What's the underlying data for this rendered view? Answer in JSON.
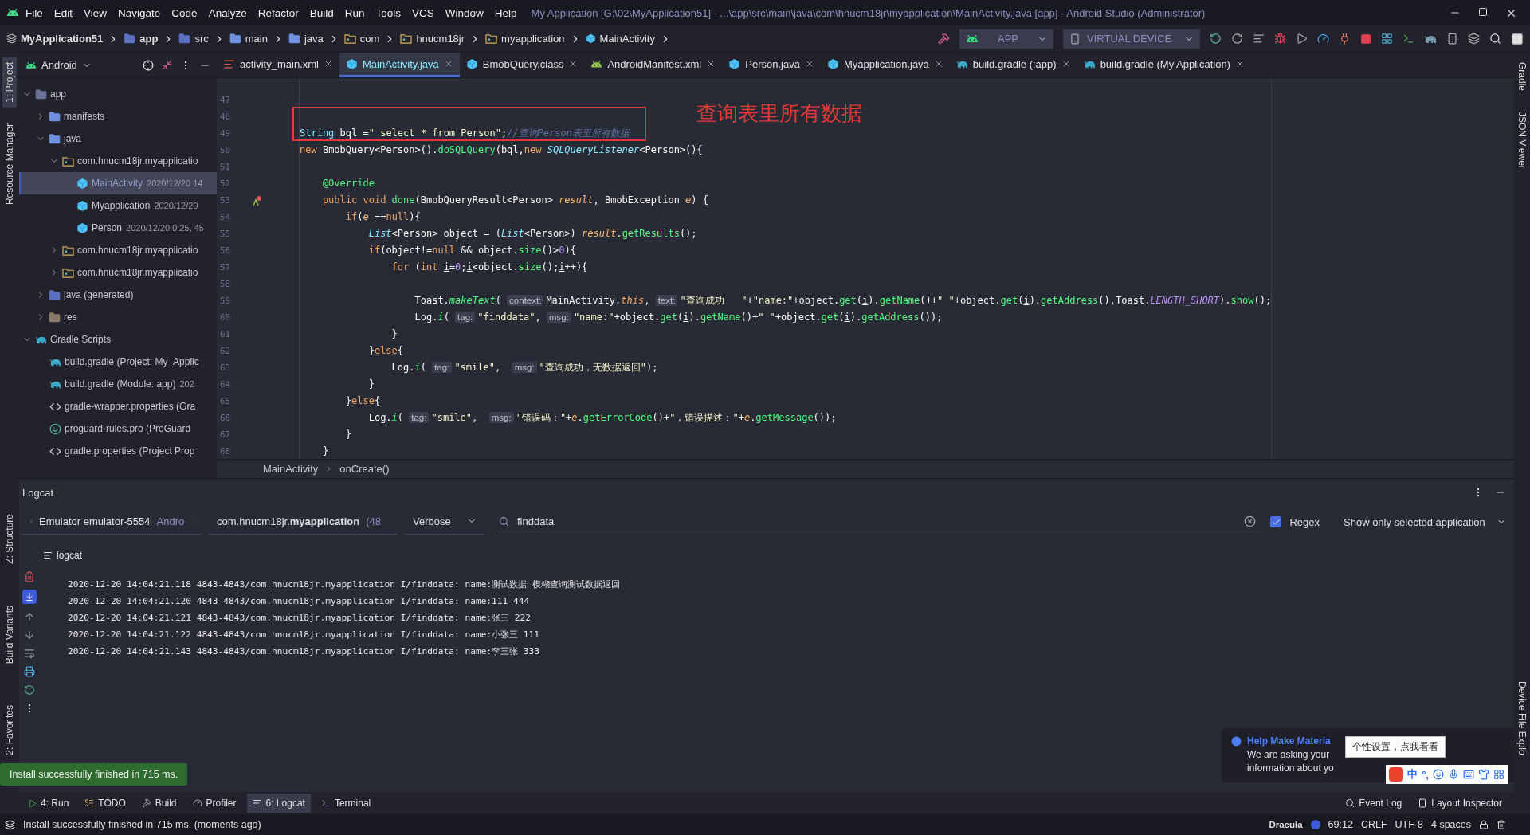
{
  "menu_bar": {
    "items": [
      "File",
      "Edit",
      "View",
      "Navigate",
      "Code",
      "Analyze",
      "Refactor",
      "Build",
      "Run",
      "Tools",
      "VCS",
      "Window",
      "Help"
    ],
    "title": "My Application [G:\\02\\MyApplication51] - ...\\app\\src\\main\\java\\com\\hnucm18jr\\myapplication\\MainActivity.java [app] - Android Studio (Administrator)"
  },
  "breadcrumbs": [
    {
      "label": "MyApplication51",
      "kind": "project"
    },
    {
      "label": "app",
      "kind": "module"
    },
    {
      "label": "src",
      "kind": "source"
    },
    {
      "label": "main",
      "kind": "folder"
    },
    {
      "label": "java",
      "kind": "folder"
    },
    {
      "label": "com",
      "kind": "package"
    },
    {
      "label": "hnucm18jr",
      "kind": "package"
    },
    {
      "label": "myapplication",
      "kind": "package"
    },
    {
      "label": "MainActivity",
      "kind": "class"
    }
  ],
  "run_toolbar": {
    "configuration": "APP",
    "device": "VIRTUAL DEVICE"
  },
  "left_tool_strip": {
    "top": [
      {
        "label": "1: Project",
        "selected": true
      },
      {
        "label": "Resource Manager",
        "selected": false
      }
    ],
    "bottom": [
      {
        "label": "Z: Structure",
        "selected": false
      },
      {
        "label": "Build Variants",
        "selected": false
      },
      {
        "label": "2: Favorites",
        "selected": false
      }
    ]
  },
  "right_tool_strip": {
    "top": [
      "Gradle",
      "JSON Viewer"
    ],
    "bottom": [
      "Device File Explo"
    ]
  },
  "project_panel": {
    "view": "Android",
    "tree": [
      {
        "label": "app",
        "kind": "module",
        "expanded": true,
        "selected": false,
        "children": [
          {
            "label": "manifests",
            "kind": "folder",
            "expanded": false,
            "selected": false
          },
          {
            "label": "java",
            "kind": "folder",
            "expanded": true,
            "selected": false,
            "children": [
              {
                "label": "com.hnucm18jr.myapplicatio",
                "kind": "package",
                "expanded": true,
                "selected": false,
                "children": [
                  {
                    "label": "MainActivity",
                    "date": "2020/12/20 14",
                    "kind": "class",
                    "selected": true
                  },
                  {
                    "label": "Myapplication",
                    "date": "2020/12/20",
                    "kind": "class",
                    "selected": false
                  },
                  {
                    "label": "Person",
                    "date": "2020/12/20 0:25, 45",
                    "kind": "class",
                    "selected": false
                  }
                ]
              },
              {
                "label": "com.hnucm18jr.myapplicatio",
                "kind": "package",
                "expanded": false,
                "selected": false
              },
              {
                "label": "com.hnucm18jr.myapplicatio",
                "kind": "package",
                "expanded": false,
                "selected": false
              }
            ]
          },
          {
            "label": "java (generated)",
            "kind": "generated",
            "expanded": false,
            "selected": false
          },
          {
            "label": "res",
            "kind": "resources",
            "expanded": false,
            "selected": false
          }
        ]
      },
      {
        "label": "Gradle Scripts",
        "kind": "gradle",
        "expanded": true,
        "selected": false,
        "children": [
          {
            "label": "build.gradle (Project: My_Applic",
            "kind": "gradle",
            "selected": false
          },
          {
            "label": "build.gradle (Module: app)",
            "date": "202",
            "kind": "gradle",
            "selected": false
          },
          {
            "label": "gradle-wrapper.properties (Gra",
            "kind": "properties",
            "selected": false
          },
          {
            "label": "proguard-rules.pro (ProGuard",
            "kind": "proguard",
            "selected": false
          },
          {
            "label": "gradle.properties (Project Prop",
            "kind": "properties",
            "selected": false
          }
        ]
      }
    ]
  },
  "editor_tabs": [
    {
      "label": "activity_main.xml",
      "kind": "layout",
      "selected": false
    },
    {
      "label": "MainActivity.java",
      "kind": "class",
      "selected": true
    },
    {
      "label": "BmobQuery.class",
      "kind": "class",
      "selected": false
    },
    {
      "label": "AndroidManifest.xml",
      "kind": "manifest",
      "selected": false
    },
    {
      "label": "Person.java",
      "kind": "class",
      "selected": false
    },
    {
      "label": "Myapplication.java",
      "kind": "class",
      "selected": false
    },
    {
      "label": "build.gradle (:app)",
      "kind": "gradle",
      "selected": false
    },
    {
      "label": "build.gradle (My Application)",
      "kind": "gradle",
      "selected": false
    }
  ],
  "code_lines": [
    {
      "number": "47"
    },
    {
      "number": "48"
    },
    {
      "number": "49",
      "segments": [
        {
          "text": "String",
          "kind": "type"
        },
        {
          "text": " bql =",
          "kind": "plain"
        },
        {
          "text": "\" select * from Person\"",
          "kind": "string"
        },
        {
          "text": ";",
          "kind": "plain"
        },
        {
          "text": "//查询Person表里所有数据",
          "kind": "comment"
        }
      ]
    },
    {
      "number": "50",
      "segments": [
        {
          "text": "new",
          "kind": "keyword"
        },
        {
          "text": " BmobQuery<Person>().",
          "kind": "plain"
        },
        {
          "text": "doSQLQuery",
          "kind": "method"
        },
        {
          "text": "(bql,",
          "kind": "plain"
        },
        {
          "text": "new",
          "kind": "keyword"
        },
        {
          "text": " SQLQueryListener",
          "kind": "type_italic"
        },
        {
          "text": "<Person>(){",
          "kind": "plain"
        }
      ]
    },
    {
      "number": "51"
    },
    {
      "number": "52",
      "segments": [
        {
          "text": "    @Override",
          "kind": "annotation"
        }
      ]
    },
    {
      "number": "53",
      "override_mark": true,
      "segments": [
        {
          "text": "    public void",
          "kind": "keyword"
        },
        {
          "text": " done",
          "kind": "method"
        },
        {
          "text": "(BmobQueryResult<Person> ",
          "kind": "plain"
        },
        {
          "text": "result",
          "kind": "param"
        },
        {
          "text": ", BmobException ",
          "kind": "plain"
        },
        {
          "text": "e",
          "kind": "param"
        },
        {
          "text": ") {",
          "kind": "plain"
        }
      ]
    },
    {
      "number": "54",
      "segments": [
        {
          "text": "        if",
          "kind": "keyword"
        },
        {
          "text": "(",
          "kind": "plain"
        },
        {
          "text": "e",
          "kind": "param"
        },
        {
          "text": " ==",
          "kind": "plain"
        },
        {
          "text": "null",
          "kind": "keyword"
        },
        {
          "text": "){",
          "kind": "plain"
        }
      ]
    },
    {
      "number": "55",
      "segments": [
        {
          "text": "            List",
          "kind": "type_italic"
        },
        {
          "text": "<Person> object = (",
          "kind": "plain"
        },
        {
          "text": "List",
          "kind": "type_italic"
        },
        {
          "text": "<Person>) ",
          "kind": "plain"
        },
        {
          "text": "result",
          "kind": "param"
        },
        {
          "text": ".",
          "kind": "plain"
        },
        {
          "text": "getResults",
          "kind": "method"
        },
        {
          "text": "();",
          "kind": "plain"
        }
      ]
    },
    {
      "number": "56",
      "segments": [
        {
          "text": "            if",
          "kind": "keyword"
        },
        {
          "text": "(object!=",
          "kind": "plain"
        },
        {
          "text": "null",
          "kind": "keyword"
        },
        {
          "text": " && object.",
          "kind": "plain"
        },
        {
          "text": "size",
          "kind": "method"
        },
        {
          "text": "()>",
          "kind": "plain"
        },
        {
          "text": "0",
          "kind": "number"
        },
        {
          "text": "){",
          "kind": "plain"
        }
      ]
    },
    {
      "number": "57",
      "segments": [
        {
          "text": "                for",
          "kind": "keyword"
        },
        {
          "text": " (",
          "kind": "plain"
        },
        {
          "text": "int ",
          "kind": "keyword"
        },
        {
          "text": "i",
          "kind": "loop_var"
        },
        {
          "text": "=",
          "kind": "plain"
        },
        {
          "text": "0",
          "kind": "number"
        },
        {
          "text": ";",
          "kind": "plain"
        },
        {
          "text": "i",
          "kind": "loop_var"
        },
        {
          "text": "<object.",
          "kind": "plain"
        },
        {
          "text": "size",
          "kind": "method"
        },
        {
          "text": "();",
          "kind": "plain"
        },
        {
          "text": "i",
          "kind": "loop_var"
        },
        {
          "text": "++){",
          "kind": "plain"
        }
      ]
    },
    {
      "number": "58"
    },
    {
      "number": "59",
      "segments": [
        {
          "text": "                    Toast.",
          "kind": "plain"
        },
        {
          "text": "makeText",
          "kind": "method_italic"
        },
        {
          "text": "( ",
          "kind": "plain"
        },
        {
          "text": "context:",
          "kind": "hint"
        },
        {
          "text": "MainActivity.",
          "kind": "plain"
        },
        {
          "text": "this",
          "kind": "keyword_italic"
        },
        {
          "text": ", ",
          "kind": "plain"
        },
        {
          "text": "text:",
          "kind": "hint"
        },
        {
          "text": "\"查询成功   \"",
          "kind": "string"
        },
        {
          "text": "+",
          "kind": "plain"
        },
        {
          "text": "\"name:\"",
          "kind": "string"
        },
        {
          "text": "+object.",
          "kind": "plain"
        },
        {
          "text": "get",
          "kind": "method"
        },
        {
          "text": "(",
          "kind": "plain"
        },
        {
          "text": "i",
          "kind": "loop_var"
        },
        {
          "text": ").",
          "kind": "plain"
        },
        {
          "text": "getName",
          "kind": "method"
        },
        {
          "text": "()+",
          "kind": "plain"
        },
        {
          "text": "\" \"",
          "kind": "string"
        },
        {
          "text": "+object.",
          "kind": "plain"
        },
        {
          "text": "get",
          "kind": "method"
        },
        {
          "text": "(",
          "kind": "plain"
        },
        {
          "text": "i",
          "kind": "loop_var"
        },
        {
          "text": ").",
          "kind": "plain"
        },
        {
          "text": "getAddress",
          "kind": "method"
        },
        {
          "text": "(),Toast.",
          "kind": "plain"
        },
        {
          "text": "LENGTH_SHORT",
          "kind": "constant"
        },
        {
          "text": ").",
          "kind": "plain"
        },
        {
          "text": "show",
          "kind": "method"
        },
        {
          "text": "();",
          "kind": "plain"
        }
      ]
    },
    {
      "number": "60",
      "segments": [
        {
          "text": "                    Log.",
          "kind": "plain"
        },
        {
          "text": "i",
          "kind": "method_italic"
        },
        {
          "text": "( ",
          "kind": "plain"
        },
        {
          "text": "tag:",
          "kind": "hint"
        },
        {
          "text": "\"finddata\"",
          "kind": "string"
        },
        {
          "text": ", ",
          "kind": "plain"
        },
        {
          "text": "msg:",
          "kind": "hint"
        },
        {
          "text": "\"name:\"",
          "kind": "string"
        },
        {
          "text": "+object.",
          "kind": "plain"
        },
        {
          "text": "get",
          "kind": "method"
        },
        {
          "text": "(",
          "kind": "plain"
        },
        {
          "text": "i",
          "kind": "loop_var"
        },
        {
          "text": ").",
          "kind": "plain"
        },
        {
          "text": "getName",
          "kind": "method"
        },
        {
          "text": "()+",
          "kind": "plain"
        },
        {
          "text": "\" \"",
          "kind": "string"
        },
        {
          "text": "+object.",
          "kind": "plain"
        },
        {
          "text": "get",
          "kind": "method"
        },
        {
          "text": "(",
          "kind": "plain"
        },
        {
          "text": "i",
          "kind": "loop_var"
        },
        {
          "text": ").",
          "kind": "plain"
        },
        {
          "text": "getAddress",
          "kind": "method"
        },
        {
          "text": "());",
          "kind": "plain"
        }
      ]
    },
    {
      "number": "61",
      "segments": [
        {
          "text": "                }",
          "kind": "plain"
        }
      ]
    },
    {
      "number": "62",
      "segments": [
        {
          "text": "            }",
          "kind": "plain"
        },
        {
          "text": "else",
          "kind": "keyword"
        },
        {
          "text": "{",
          "kind": "plain"
        }
      ]
    },
    {
      "number": "63",
      "segments": [
        {
          "text": "                Log.",
          "kind": "plain"
        },
        {
          "text": "i",
          "kind": "method_italic"
        },
        {
          "text": "( ",
          "kind": "plain"
        },
        {
          "text": "tag:",
          "kind": "hint"
        },
        {
          "text": "\"smile\"",
          "kind": "string"
        },
        {
          "text": ",  ",
          "kind": "plain"
        },
        {
          "text": "msg:",
          "kind": "hint"
        },
        {
          "text": "\"查询成功，无数据返回\"",
          "kind": "string"
        },
        {
          "text": ");",
          "kind": "plain"
        }
      ]
    },
    {
      "number": "64",
      "segments": [
        {
          "text": "            }",
          "kind": "plain"
        }
      ]
    },
    {
      "number": "65",
      "segments": [
        {
          "text": "        }",
          "kind": "plain"
        },
        {
          "text": "else",
          "kind": "keyword"
        },
        {
          "text": "{",
          "kind": "plain"
        }
      ]
    },
    {
      "number": "66",
      "segments": [
        {
          "text": "            Log.",
          "kind": "plain"
        },
        {
          "text": "i",
          "kind": "method_italic"
        },
        {
          "text": "( ",
          "kind": "plain"
        },
        {
          "text": "tag:",
          "kind": "hint"
        },
        {
          "text": "\"smile\"",
          "kind": "string"
        },
        {
          "text": ",  ",
          "kind": "plain"
        },
        {
          "text": "msg:",
          "kind": "hint"
        },
        {
          "text": "\"错误码：\"",
          "kind": "string"
        },
        {
          "text": "+",
          "kind": "plain"
        },
        {
          "text": "e",
          "kind": "param"
        },
        {
          "text": ".",
          "kind": "plain"
        },
        {
          "text": "getErrorCode",
          "kind": "method"
        },
        {
          "text": "()+",
          "kind": "plain"
        },
        {
          "text": "\"，错误描述：\"",
          "kind": "string"
        },
        {
          "text": "+",
          "kind": "plain"
        },
        {
          "text": "e",
          "kind": "param"
        },
        {
          "text": ".",
          "kind": "plain"
        },
        {
          "text": "getMessage",
          "kind": "method"
        },
        {
          "text": "());",
          "kind": "plain"
        }
      ]
    },
    {
      "number": "67",
      "segments": [
        {
          "text": "        }",
          "kind": "plain"
        }
      ]
    },
    {
      "number": "68",
      "segments": [
        {
          "text": "    }",
          "kind": "plain"
        }
      ]
    }
  ],
  "annotation": {
    "text": "查询表里所有数据"
  },
  "editor_breadcrumbs": [
    "MainActivity",
    "onCreate()"
  ],
  "logcat": {
    "title": "Logcat",
    "device": "Emulator emulator-5554",
    "device_suffix": "Andro",
    "process": "com.hnucm18jr.**myapplication**",
    "process_suffix": "(48",
    "level": "Verbose",
    "search": "finddata",
    "regex": true,
    "regex_label": "Regex",
    "filter": "Show only selected application",
    "tab": "logcat",
    "scroll_to_end": true,
    "lines": [
      "2020-12-20 14:04:21.118 4843-4843/com.hnucm18jr.myapplication I/finddata: name:测试数据 模糊查询测试数据返回",
      "2020-12-20 14:04:21.120 4843-4843/com.hnucm18jr.myapplication I/finddata: name:111 444",
      "2020-12-20 14:04:21.121 4843-4843/com.hnucm18jr.myapplication I/finddata: name:张三 222",
      "2020-12-20 14:04:21.122 4843-4843/com.hnucm18jr.myapplication I/finddata: name:小张三 111",
      "2020-12-20 14:04:21.143 4843-4843/com.hnucm18jr.myapplication I/finddata: name:李三张 333"
    ]
  },
  "toast": "Install successfully finished in 715 ms.",
  "notification": {
    "title": "Help Make Materia",
    "lines": [
      "We are asking your",
      "information about yo"
    ]
  },
  "ime": {
    "tooltip": "个性设置，点我看看",
    "mode": "中",
    "punctuation": "°,"
  },
  "bottom_tools": {
    "left": [
      {
        "label": "4: Run",
        "kind": "run",
        "selected": false
      },
      {
        "label": "TODO",
        "kind": "todo",
        "selected": false
      },
      {
        "label": "Build",
        "kind": "build",
        "selected": false
      },
      {
        "label": "Profiler",
        "kind": "profiler",
        "selected": false
      },
      {
        "label": "6: Logcat",
        "kind": "logcat",
        "selected": true
      },
      {
        "label": "Terminal",
        "kind": "terminal",
        "selected": false
      }
    ],
    "right": [
      {
        "label": "Event Log",
        "kind": "event"
      },
      {
        "label": "Layout Inspector",
        "kind": "inspector"
      }
    ]
  },
  "status_bar": {
    "message": "Install successfully finished in 715 ms. (moments ago)",
    "theme": "Dracula",
    "position": "69:12",
    "line_separator": "CRLF",
    "encoding": "UTF-8",
    "indent": "4 spaces"
  }
}
